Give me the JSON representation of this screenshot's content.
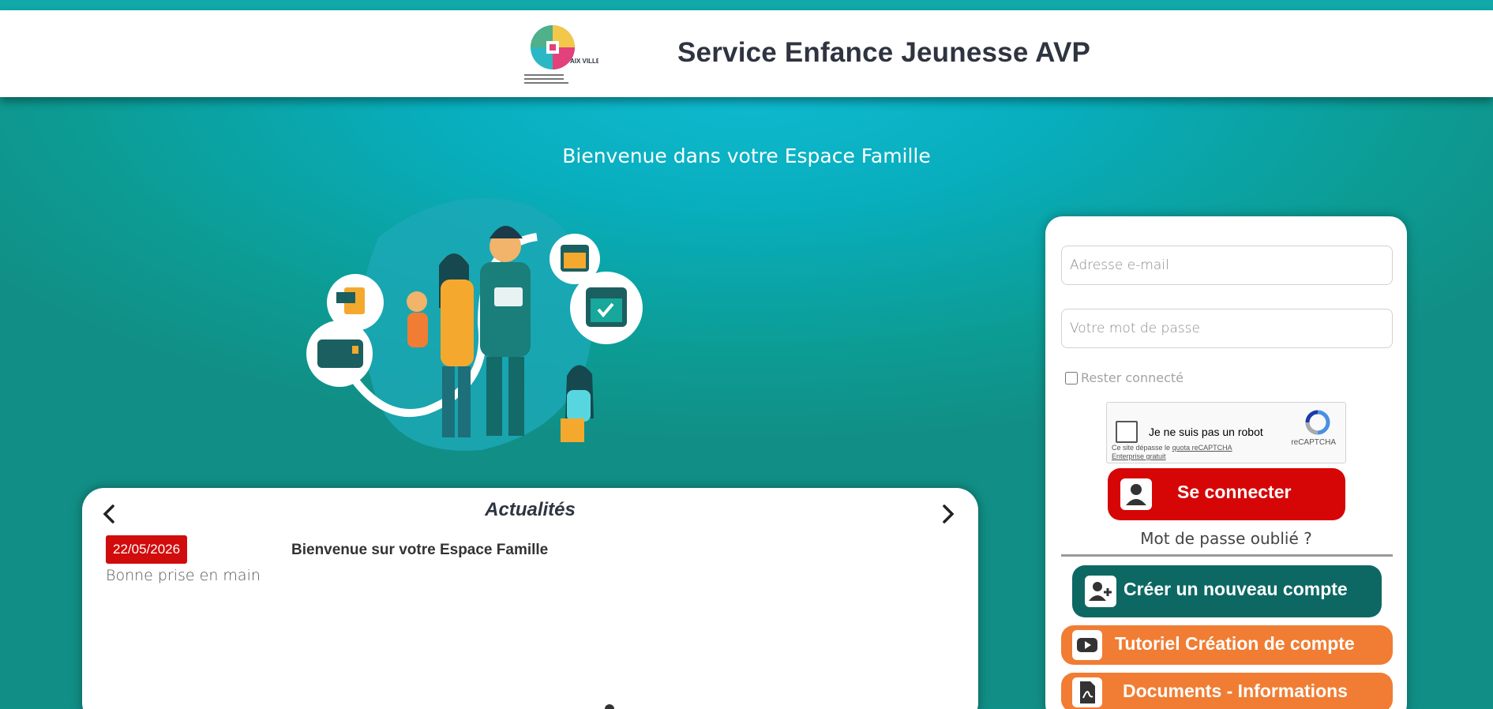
{
  "header": {
    "title": "Service Enfance Jeunesse AVP",
    "logo_text": "AIX VILLEMAUR PÂLIS"
  },
  "welcome": "Bienvenue dans votre Espace Famille",
  "news": {
    "title": "Actualités",
    "date": "22/05/2026",
    "headline": "Bienvenue sur votre Espace Famille",
    "body": "Bonne prise en main"
  },
  "login": {
    "email_placeholder": "Adresse e-mail",
    "password_placeholder": "Votre mot de passe",
    "remember_label": "Rester connecté",
    "captcha_label": "Je ne suis pas un robot",
    "captcha_note_1": "Ce site dépasse le",
    "captcha_note_link": "quota reCAPTCHA Enterprise gratuit",
    "captcha_brand": "reCAPTCHA",
    "connect_label": "Se connecter",
    "forgot_label": "Mot de passe oublié ?",
    "create_label": "Créer un nouveau compte",
    "tutorial_label": "Tutoriel Création de compte",
    "documents_label": "Documents - Informations"
  },
  "colors": {
    "teal": "#0c9c94",
    "red": "#d60606",
    "dark_teal": "#0d6863",
    "orange": "#f07d33"
  },
  "icons": [
    "user-icon",
    "add-user-icon",
    "youtube-icon",
    "pdf-icon",
    "chevron-left-icon",
    "chevron-right-icon"
  ]
}
